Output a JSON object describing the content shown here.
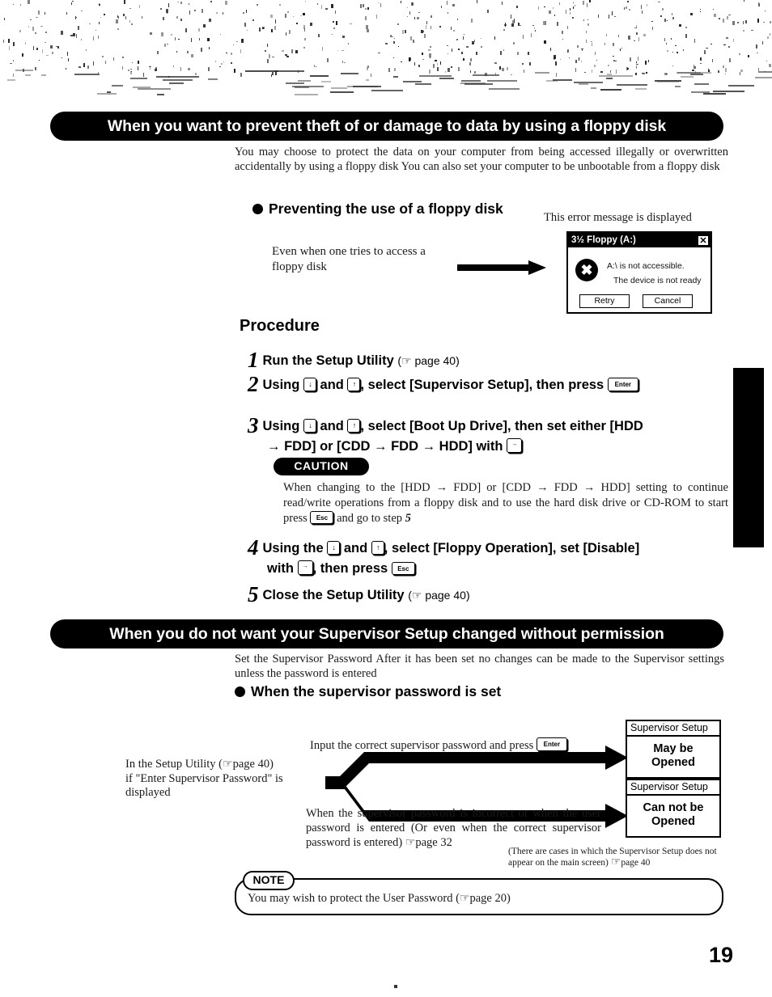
{
  "page": {
    "number": "19"
  },
  "section1": {
    "banner": "When you want to prevent theft of or damage to data by using a floppy disk",
    "intro": "You may choose to protect the data on your computer from being accessed illegally or overwritten accidentally by using a floppy disk  You can also set your computer to be unbootable from a floppy disk",
    "bullet_heading": "Preventing the use of a floppy disk",
    "arrow_caption": "Even when one tries to access a floppy disk",
    "error_label": "This error message is displayed",
    "dialog": {
      "title": "3½ Floppy (A:)",
      "close_label": "✕",
      "icon": "error-stop-icon",
      "line1": "A:\\ is not accessible.",
      "line2": "The device is not ready",
      "retry_label": "Retry",
      "cancel_label": "Cancel"
    },
    "procedure_title": "Procedure",
    "steps": [
      {
        "num": "1",
        "text_before": "Run the Setup Utility",
        "pageref": "page 40"
      },
      {
        "num": "2",
        "text_a": "Using",
        "key1": "↓",
        "text_b": "and",
        "key2": "↑",
        "text_c": ", select [Supervisor Setup], then press",
        "key3": "Enter"
      },
      {
        "num": "3",
        "text_a": "Using",
        "key1": "↓",
        "text_b": "and",
        "key2": "↑",
        "text_c": ", select [Boot Up Drive], then set either [HDD",
        "text_d": "→ FDD] or [CDD → FDD → HDD] with",
        "key3": "SPACE"
      },
      {
        "num": "4",
        "text_a": "Using the",
        "key1": "↓",
        "text_b": "and",
        "key2": "↑",
        "text_c": ", select [Floppy Operation], set [Disable]",
        "text_d": "with",
        "key3": "SPACE",
        "text_e": ", then press",
        "key4": "Esc"
      },
      {
        "num": "5",
        "text_before": "Close the Setup Utility",
        "pageref": "page 40"
      }
    ],
    "caution": {
      "badge": "CAUTION",
      "text_a": "When changing to the [HDD → FDD] or [CDD → FDD → HDD] setting to continue read/write operations from a floppy disk and to use the hard disk drive or CD-ROM to start  press",
      "key": "Esc",
      "text_b": "and go to step",
      "step_ref": "5"
    }
  },
  "section2": {
    "banner": "When you do not want your Supervisor Setup changed without permission",
    "intro": "Set the Supervisor Password  After it has been set  no changes can be made to the Supervisor settings unless the password is entered",
    "bullet_heading": "When the supervisor password is set",
    "flow": {
      "left_text_a": "In the Setup Utility  (",
      "left_pageref": "page 40)",
      "left_text_b": "if \"Enter Supervisor Password\" is displayed",
      "top_text": "Input the correct supervisor password and press",
      "top_key": "Enter",
      "bottom_text": "When the supervisor password is incorrect or when the user password is entered  (Or  even when the correct supervisor password is entered)",
      "bottom_pageref": "page 32",
      "footnote": "(There are cases in which the Supervisor Setup does not appear on the main screen)",
      "footnote_pageref": "page 40",
      "result_open": {
        "head": "Supervisor Setup",
        "body_line1": "May be",
        "body_line2": "Opened"
      },
      "result_closed": {
        "head": "Supervisor Setup",
        "body_line1": "Can not be",
        "body_line2": "Opened"
      }
    }
  },
  "note": {
    "badge": "NOTE",
    "text_a": "You may wish to protect the User Password (",
    "pageref": "page 20)"
  },
  "glyphs": {
    "hand": "☞"
  }
}
